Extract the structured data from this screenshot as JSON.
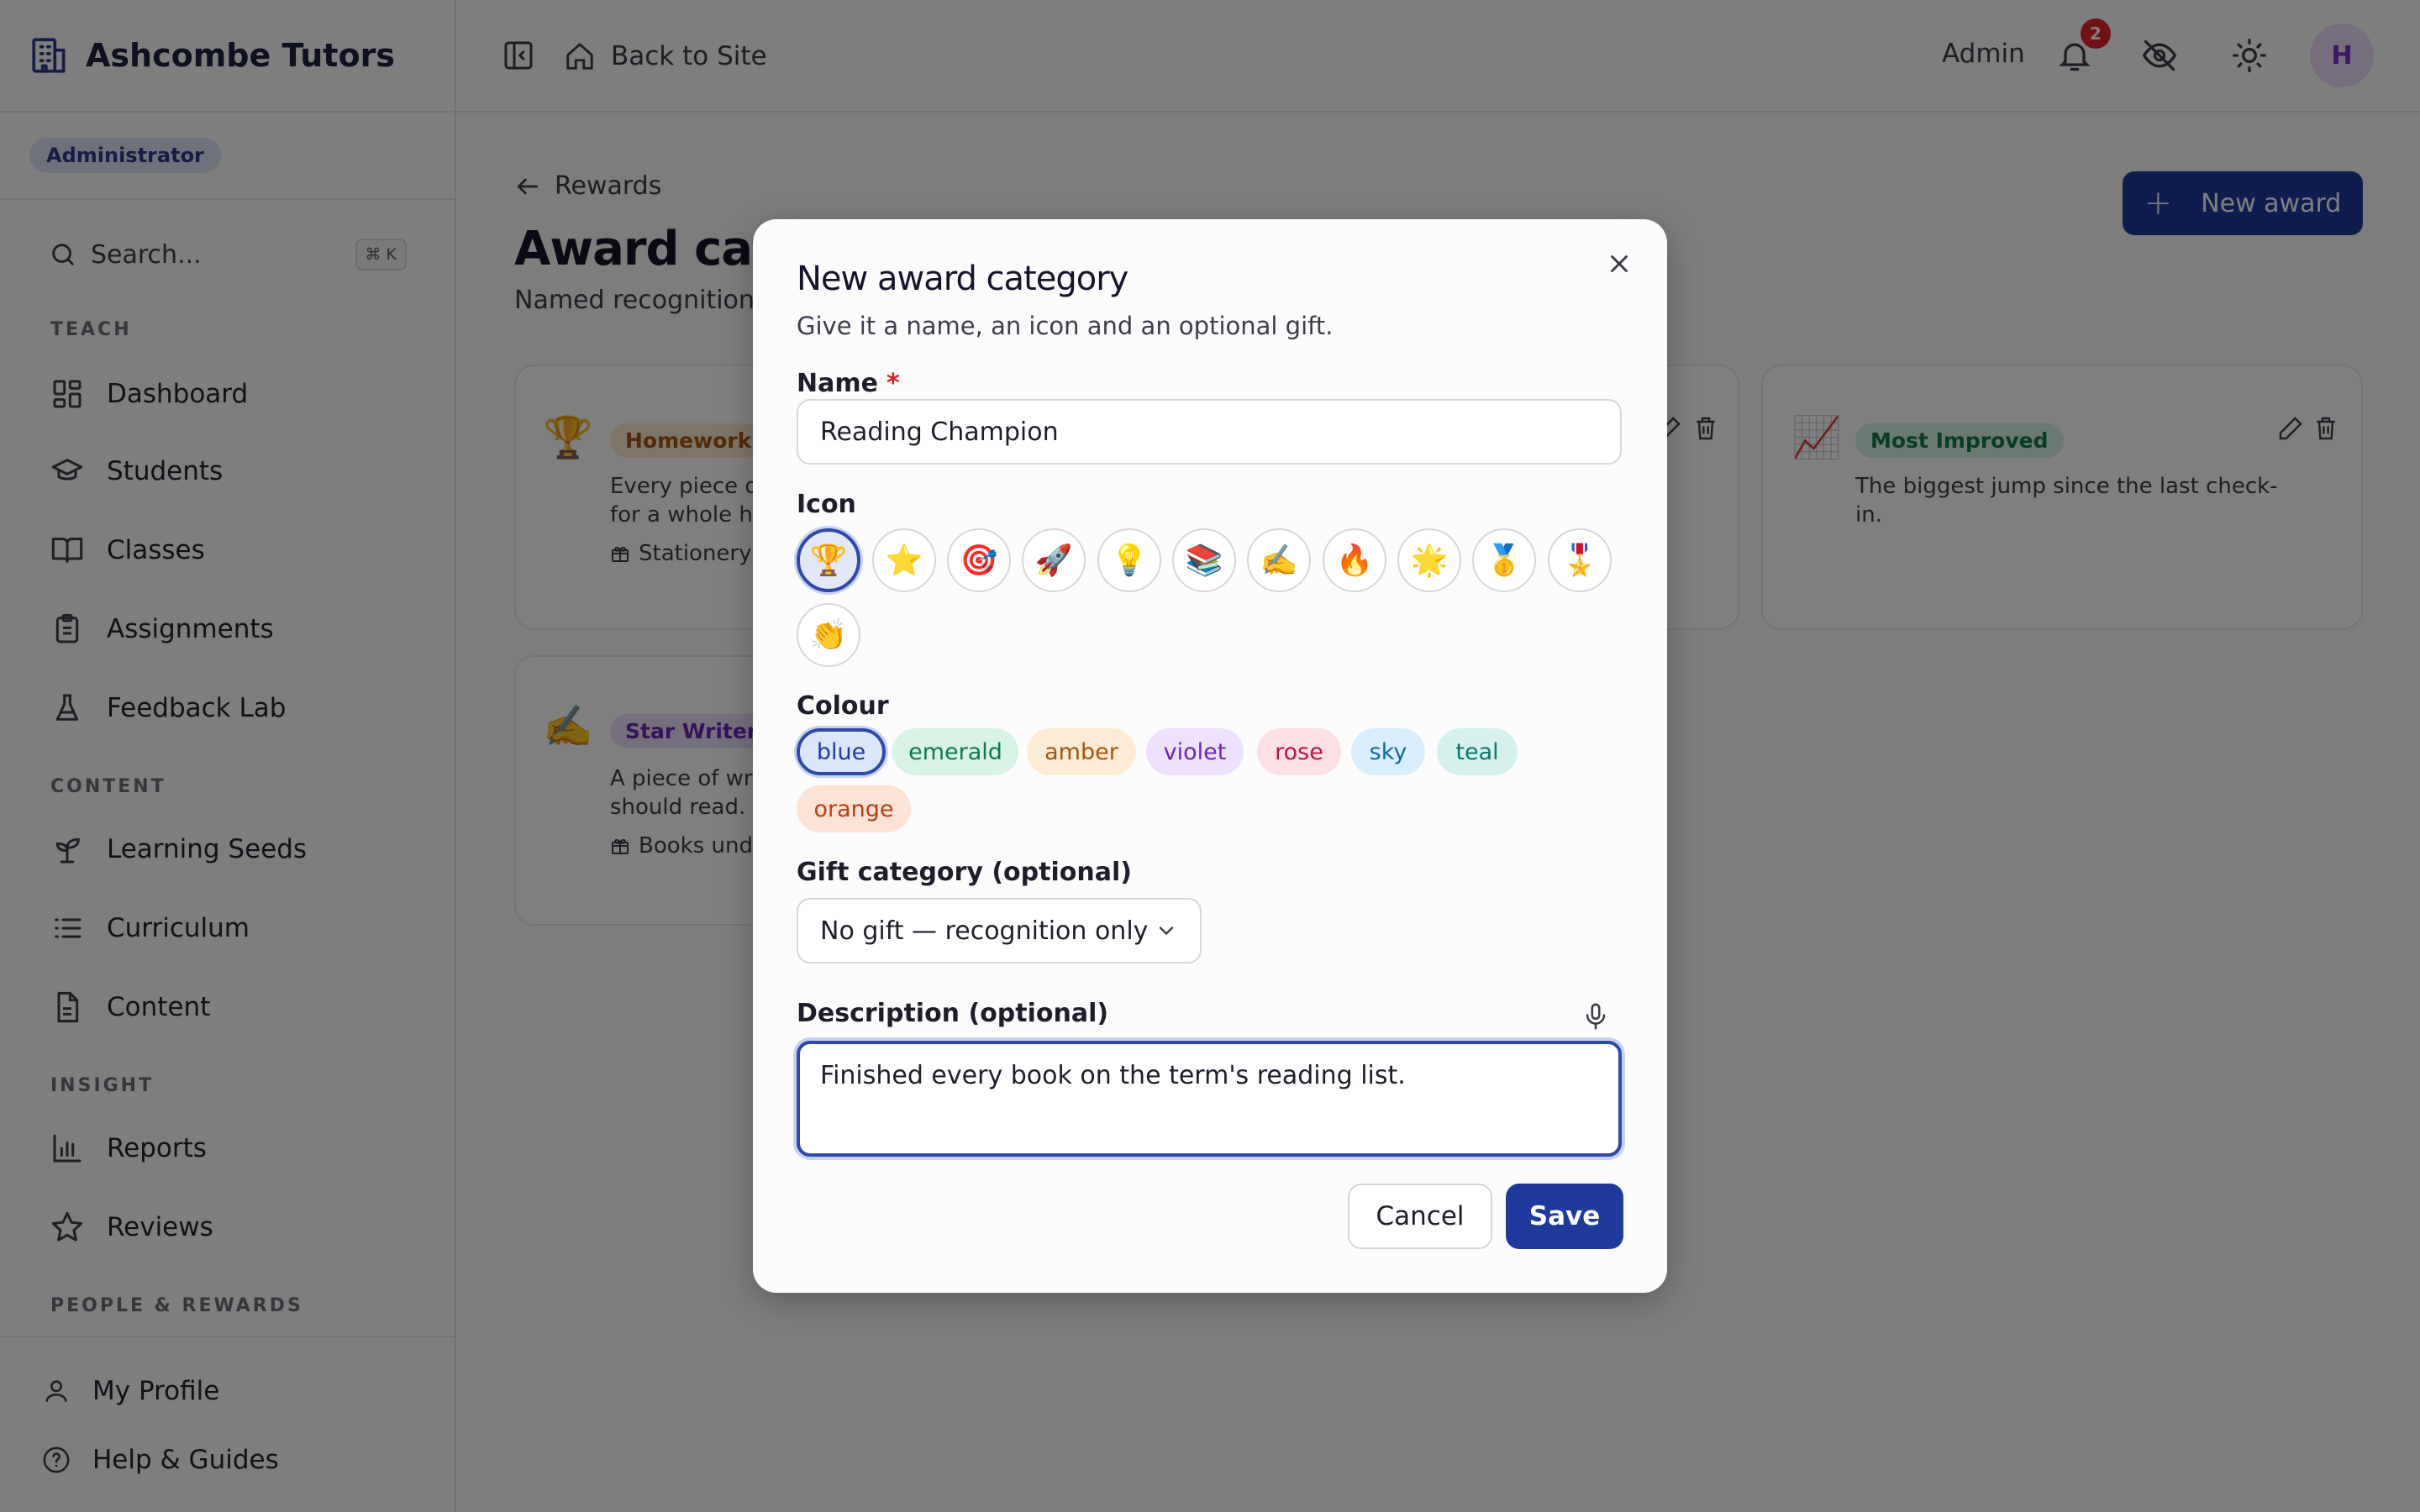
{
  "sidebar": {
    "brand": "Ashcombe Tutors",
    "role": "Administrator",
    "search_placeholder": "Search...",
    "search_shortcut": "⌘ K",
    "sections": {
      "teach": "TEACH",
      "content": "CONTENT",
      "insight": "INSIGHT",
      "people": "PEOPLE & REWARDS"
    },
    "items": {
      "dashboard": "Dashboard",
      "students": "Students",
      "classes": "Classes",
      "assignments": "Assignments",
      "feedback_lab": "Feedback Lab",
      "learning_seeds": "Learning Seeds",
      "curriculum": "Curriculum",
      "content": "Content",
      "reports": "Reports",
      "reviews": "Reviews"
    },
    "bottom": {
      "profile": "My Profile",
      "help": "Help & Guides"
    }
  },
  "topbar": {
    "back_to_site": "Back to Site",
    "admin": "Admin",
    "notification_count": "2",
    "avatar_initial": "H"
  },
  "main": {
    "breadcrumb": "Rewards",
    "title": "Award categ",
    "subtitle": "Named recognitions",
    "new_award": "New award",
    "cards": [
      {
        "emoji": "🏆",
        "name": "Homework H",
        "desc_line1": "Every piece of",
        "desc_line2": "for a whole ho",
        "gift": "Stationery"
      },
      {
        "emoji": "📈",
        "name": "Most Improved",
        "desc_line1": "The biggest jump since the last check-",
        "desc_line2": "in."
      },
      {
        "emoji": "✍️",
        "name": "Star Writer",
        "desc_line1": "A piece of writ",
        "desc_line2": "should read.",
        "gift": "Books unde"
      }
    ]
  },
  "modal": {
    "title": "New award category",
    "subtitle": "Give it a name, an icon and an optional gift.",
    "name_label": "Name",
    "required_mark": "*",
    "name_value": "Reading Champion",
    "icon_label": "Icon",
    "icons": [
      "🏆",
      "⭐",
      "🎯",
      "🚀",
      "💡",
      "📚",
      "✍️",
      "🔥",
      "🌟",
      "🥇",
      "🎖️",
      "👏"
    ],
    "selected_icon": "🏆",
    "colour_label": "Colour",
    "colours": [
      "blue",
      "emerald",
      "amber",
      "violet",
      "rose",
      "sky",
      "teal",
      "orange"
    ],
    "selected_colour": "blue",
    "colour_hex": {
      "blue": "#dbe6fb",
      "emerald": "#d7f3e6",
      "amber": "#fdebd3",
      "violet": "#ede1fd",
      "rose": "#fde0e6",
      "sky": "#d9eefc",
      "teal": "#d5f1ed",
      "orange": "#fde2d6"
    },
    "gift_label": "Gift category (optional)",
    "gift_value": "No gift — recognition only",
    "description_label": "Description (optional)",
    "description_value": "Finished every book on the term's reading list.",
    "cancel": "Cancel",
    "save": "Save"
  }
}
